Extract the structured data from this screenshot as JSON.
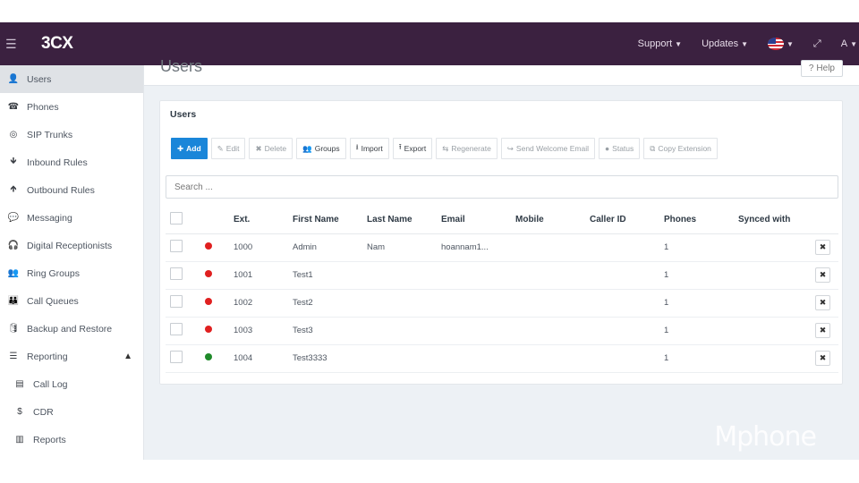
{
  "topbar": {
    "logo": "3CX",
    "support": "Support",
    "updates": "Updates",
    "user_initial": "A"
  },
  "sidebar": {
    "items": [
      {
        "label": "Users",
        "icon": "user-icon",
        "glyph": "👤",
        "active": true
      },
      {
        "label": "Phones",
        "icon": "phone-icon",
        "glyph": "☎"
      },
      {
        "label": "SIP Trunks",
        "icon": "globe-icon",
        "glyph": "◎"
      },
      {
        "label": "Inbound Rules",
        "icon": "arrow-down-icon",
        "glyph": "🡻"
      },
      {
        "label": "Outbound Rules",
        "icon": "arrow-up-icon",
        "glyph": "🡹"
      },
      {
        "label": "Messaging",
        "icon": "chat-icon",
        "glyph": "💬"
      },
      {
        "label": "Digital Receptionists",
        "icon": "headset-icon",
        "glyph": "🎧"
      },
      {
        "label": "Ring Groups",
        "icon": "group-icon",
        "glyph": "👥"
      },
      {
        "label": "Call Queues",
        "icon": "queue-icon",
        "glyph": "👪"
      },
      {
        "label": "Backup and Restore",
        "icon": "database-icon",
        "glyph": "🛢"
      },
      {
        "label": "Reporting",
        "icon": "list-icon",
        "glyph": "☰",
        "expanded": true
      },
      {
        "label": "Call Log",
        "icon": "file-icon",
        "glyph": "▤",
        "sub": true
      },
      {
        "label": "CDR",
        "icon": "dollar-icon",
        "glyph": "$",
        "sub": true
      },
      {
        "label": "Reports",
        "icon": "report-icon",
        "glyph": "▥",
        "sub": true
      }
    ]
  },
  "page": {
    "title": "Users",
    "help": "Help"
  },
  "panel": {
    "title": "Users",
    "search_placeholder": "Search ...",
    "toolbar": {
      "add": "Add",
      "edit": "Edit",
      "delete": "Delete",
      "groups": "Groups",
      "import": "Import",
      "export": "Export",
      "regenerate": "Regenerate",
      "send_welcome": "Send Welcome Email",
      "status": "Status",
      "copy_extension": "Copy Extension"
    },
    "columns": {
      "ext": "Ext.",
      "first_name": "First Name",
      "last_name": "Last Name",
      "email": "Email",
      "mobile": "Mobile",
      "caller_id": "Caller ID",
      "phones": "Phones",
      "synced_with": "Synced with"
    },
    "rows": [
      {
        "ext": "1000",
        "first": "Admin",
        "last": "Nam",
        "email": "hoannam1...",
        "mobile": "",
        "caller_id": "",
        "phones": "1",
        "synced": "",
        "status_color": "#e02020"
      },
      {
        "ext": "1001",
        "first": "Test1",
        "last": "",
        "email": "",
        "mobile": "",
        "caller_id": "",
        "phones": "1",
        "synced": "",
        "status_color": "#e02020"
      },
      {
        "ext": "1002",
        "first": "Test2",
        "last": "",
        "email": "",
        "mobile": "",
        "caller_id": "",
        "phones": "1",
        "synced": "",
        "status_color": "#e02020"
      },
      {
        "ext": "1003",
        "first": "Test3",
        "last": "",
        "email": "",
        "mobile": "",
        "caller_id": "",
        "phones": "1",
        "synced": "",
        "status_color": "#e02020"
      },
      {
        "ext": "1004",
        "first": "Test3333",
        "last": "",
        "email": "",
        "mobile": "",
        "caller_id": "",
        "phones": "1",
        "synced": "",
        "status_color": "#1f8a2a"
      }
    ]
  },
  "watermark": "Mphone"
}
